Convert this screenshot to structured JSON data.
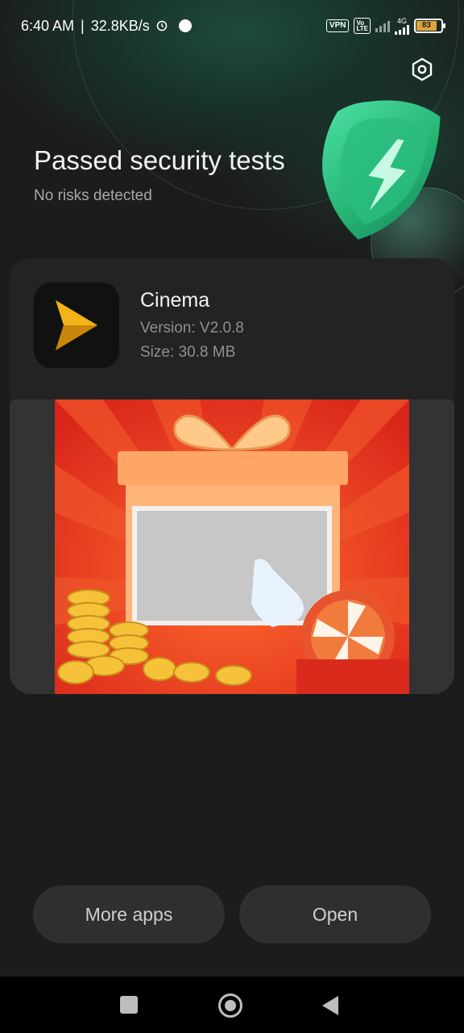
{
  "status_bar": {
    "time": "6:40 AM",
    "speed": "32.8KB/s",
    "vpn_label": "VPN",
    "volte_label": "VoLTE",
    "network_label": "4G",
    "battery": "83",
    "icons": [
      "alarm-icon",
      "notification-dot-icon",
      "signal-icon",
      "battery-icon"
    ]
  },
  "header": {
    "title": "Passed security tests",
    "subtitle": "No risks detected",
    "settings_icon": "settings-icon",
    "badge_icon": "shield-bolt-icon"
  },
  "app": {
    "name": "Cinema",
    "version": "Version: V2.0.8",
    "size": "Size: 30.8 MB",
    "icon": "play-logo-icon"
  },
  "banner": {
    "description_icon": "gift-scratch-card-ad"
  },
  "actions": {
    "more_apps_label": "More apps",
    "open_label": "Open"
  },
  "nav": {
    "recents_icon": "square-recents-icon",
    "home_icon": "circle-home-icon",
    "back_icon": "triangle-back-icon"
  },
  "colors": {
    "background": "#1c1c1c",
    "card": "#232323",
    "accent_green": "#2fc98a",
    "app_icon_yellow": "#f3b417",
    "banner_red": "#e63a1e"
  }
}
